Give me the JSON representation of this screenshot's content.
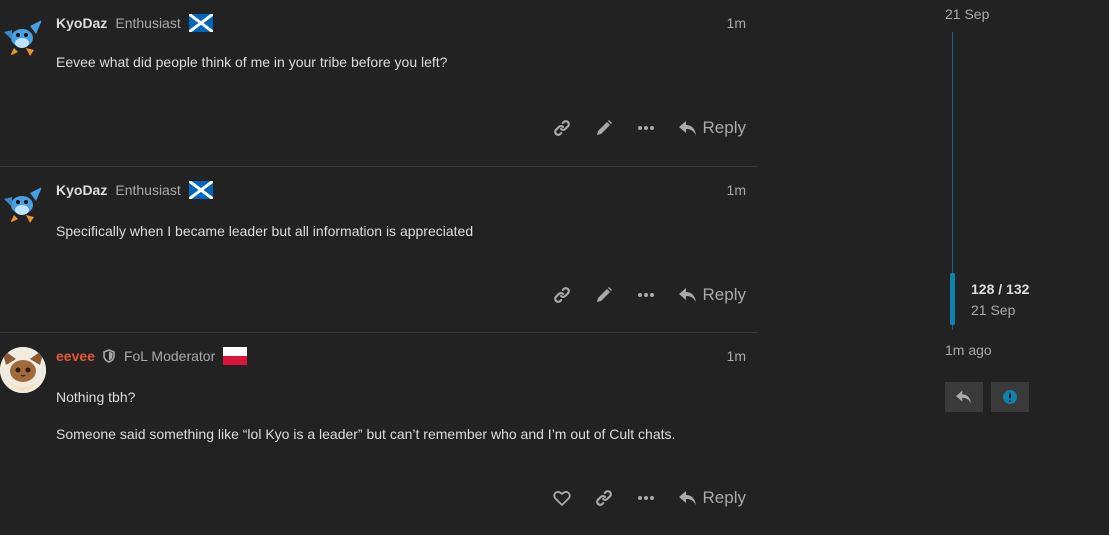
{
  "posts": [
    {
      "username": "KyoDaz",
      "user_title": "Enthusiast",
      "flag": "scotland-flag",
      "date": "1m",
      "paragraphs": [
        "Eevee what did people think of me in your tribe before you left?"
      ],
      "actions": [
        "link-icon",
        "pencil-icon",
        "more-icon"
      ],
      "reply_label": "Reply"
    },
    {
      "username": "KyoDaz",
      "user_title": "Enthusiast",
      "flag": "scotland-flag",
      "date": "1m",
      "paragraphs": [
        "Specifically when I became leader but all information is appreciated"
      ],
      "actions": [
        "link-icon",
        "pencil-icon",
        "more-icon"
      ],
      "reply_label": "Reply"
    },
    {
      "username": "eevee",
      "user_title": "FoL Moderator",
      "flag": "poland-flag",
      "date": "1m",
      "paragraphs": [
        "Nothing tbh?",
        "Someone said something like “lol Kyo is a leader” but can’t remember who and I’m out of Cult chats."
      ],
      "actions": [
        "heart-icon",
        "link-icon",
        "more-icon"
      ],
      "reply_label": "Reply"
    }
  ],
  "timeline": {
    "top_date": "21 Sep",
    "position": "128 / 132",
    "position_date": "21 Sep",
    "last_activity": "1m ago",
    "progress": 0.97
  },
  "colors": {
    "background": "#222222",
    "text": "#dddddd",
    "muted": "#a9a9a9",
    "moderator_name": "#e45735",
    "accent": "#0f82af"
  }
}
